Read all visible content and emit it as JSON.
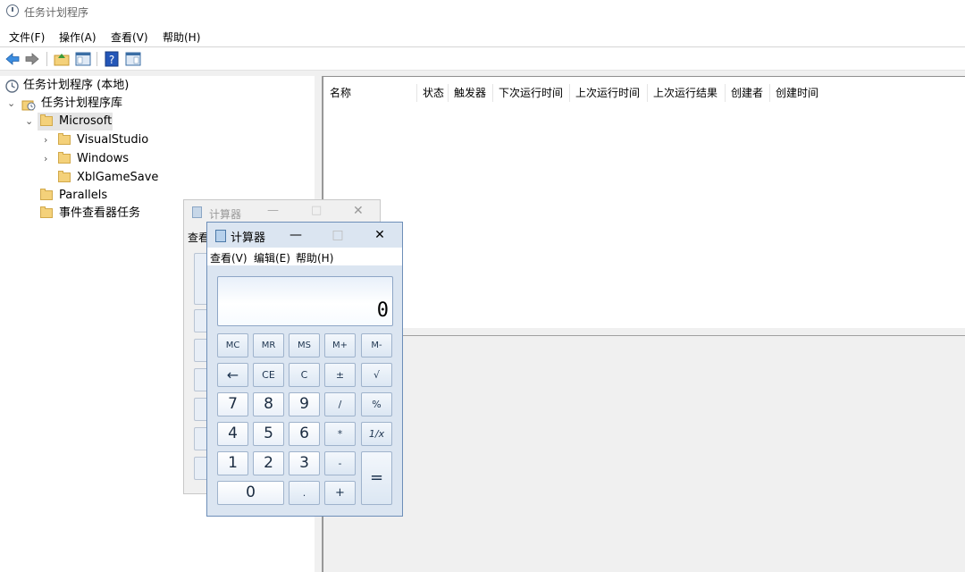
{
  "window": {
    "title": "任务计划程序"
  },
  "menubar": [
    "文件(F)",
    "操作(A)",
    "查看(V)",
    "帮助(H)"
  ],
  "toolbar": {
    "icons": [
      "back-arrow-icon",
      "forward-arrow-icon",
      "folder-up-icon",
      "show-hide-pane-icon",
      "help-icon",
      "action-pane-icon"
    ]
  },
  "tree": [
    {
      "label": "任务计划程序 (本地)",
      "icon": "clock-icon",
      "level": 0
    },
    {
      "label": "任务计划程序库",
      "icon": "library-icon",
      "level": 1,
      "expanded": true
    },
    {
      "label": "Microsoft",
      "icon": "folder-icon",
      "level": 2,
      "expanded": true,
      "selected": true
    },
    {
      "label": "VisualStudio",
      "icon": "folder-icon",
      "level": 3,
      "collapsed": true
    },
    {
      "label": "Windows",
      "icon": "folder-icon",
      "level": 3,
      "collapsed": true
    },
    {
      "label": "XblGameSave",
      "icon": "folder-icon",
      "level": 3
    },
    {
      "label": "Parallels",
      "icon": "folder-icon",
      "level": 2
    },
    {
      "label": "事件查看器任务",
      "icon": "folder-icon",
      "level": 2
    }
  ],
  "columns": [
    "名称",
    "状态",
    "触发器",
    "下次运行时间",
    "上次运行时间",
    "上次运行结果",
    "创建者",
    "创建时间"
  ],
  "calc_background": {
    "title": "计算器",
    "menu_partial": "查看"
  },
  "calculator": {
    "title": "计算器",
    "controls": {
      "minimize": "—",
      "maximize": "□",
      "close": "✕"
    },
    "menu": [
      "查看(V)",
      "编辑(E)",
      "帮助(H)"
    ],
    "display": "0",
    "keys": {
      "row_mem": [
        "MC",
        "MR",
        "MS",
        "M+",
        "M-"
      ],
      "row_edit": [
        "←",
        "CE",
        "C",
        "±",
        "√"
      ],
      "row_7": [
        "7",
        "8",
        "9",
        "/",
        "%"
      ],
      "row_4": [
        "4",
        "5",
        "6",
        "*",
        "1/x"
      ],
      "row_1": [
        "1",
        "2",
        "3",
        "-",
        "="
      ],
      "row_0": [
        "0",
        ".",
        "+"
      ]
    }
  }
}
